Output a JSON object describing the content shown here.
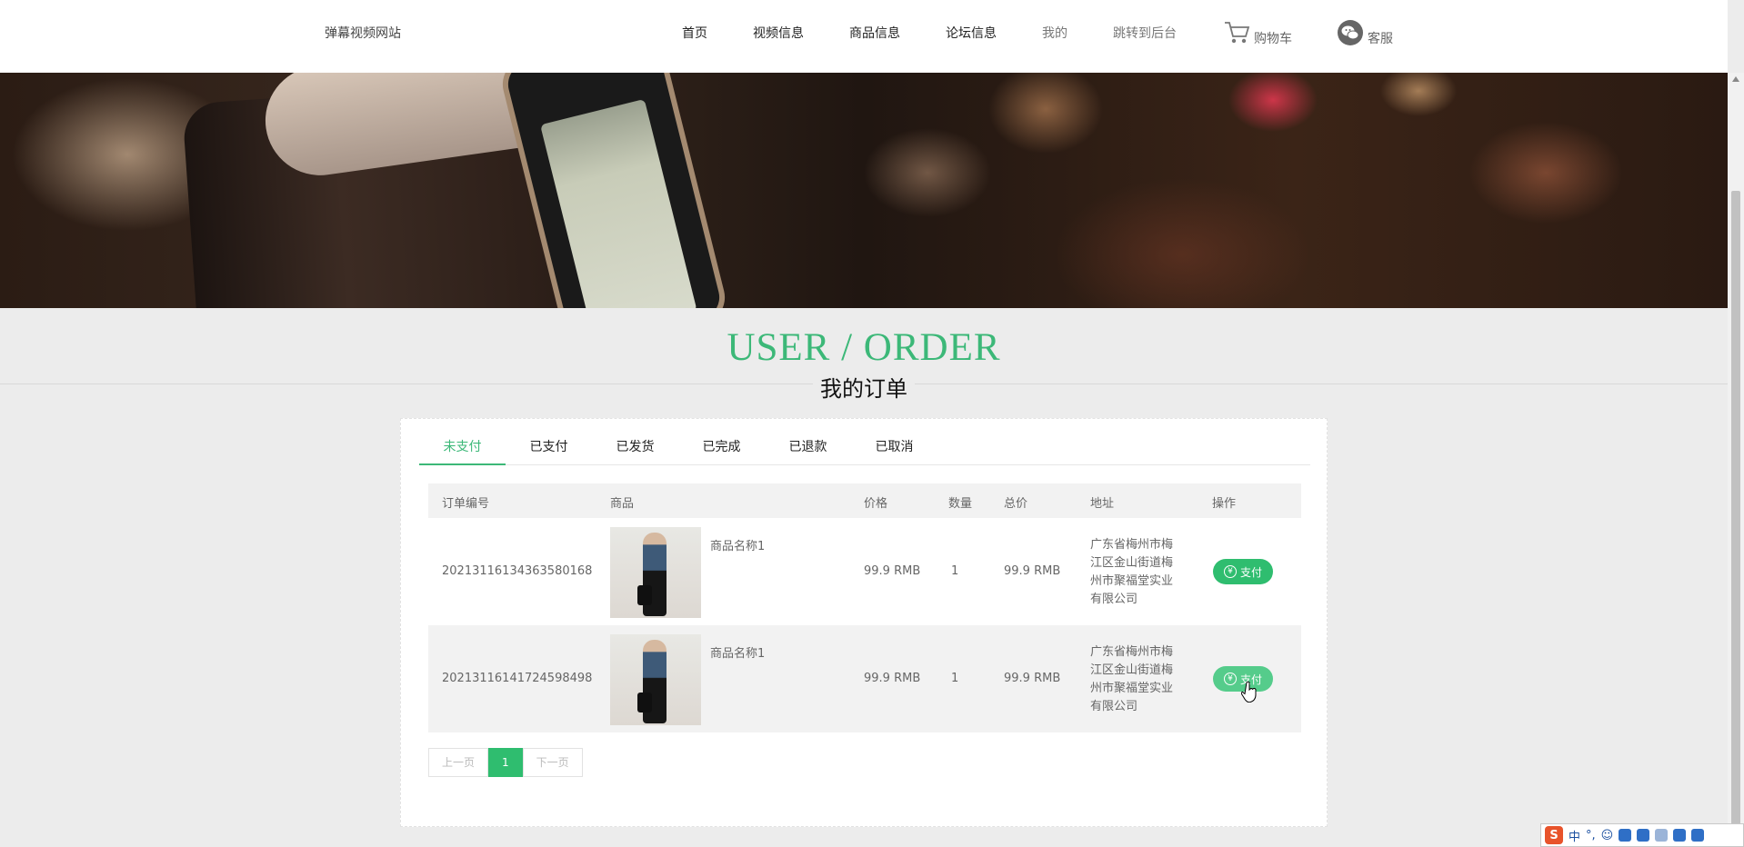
{
  "site": {
    "name": "弹幕视频网站"
  },
  "nav": {
    "items": [
      "首页",
      "视频信息",
      "商品信息",
      "论坛信息",
      "我的",
      "跳转到后台"
    ],
    "cart": "购物车",
    "service": "客服"
  },
  "page": {
    "title_en": "USER / ORDER",
    "title_cn": "我的订单"
  },
  "tabs": [
    "未支付",
    "已支付",
    "已发货",
    "已完成",
    "已退款",
    "已取消"
  ],
  "active_tab": "未支付",
  "table": {
    "headers": [
      "订单编号",
      "商品",
      "价格",
      "数量",
      "总价",
      "地址",
      "操作"
    ],
    "rows": [
      {
        "order_no": "20213116134363580168",
        "product": "商品名称1",
        "price": "99.9 RMB",
        "qty": "1",
        "total": "99.9 RMB",
        "address": "广东省梅州市梅江区金山街道梅州市聚福堂实业有限公司",
        "action": "支付"
      },
      {
        "order_no": "20213116141724598498",
        "product": "商品名称1",
        "price": "99.9 RMB",
        "qty": "1",
        "total": "99.9 RMB",
        "address": "广东省梅州市梅江区金山街道梅州市聚福堂实业有限公司",
        "action": "支付"
      }
    ]
  },
  "pagination": {
    "prev": "上一页",
    "current": "1",
    "next": "下一页"
  },
  "ime": {
    "logo": "S",
    "mode": "中"
  },
  "colors": {
    "accent": "#3cb878",
    "button": "#2fbd6f"
  }
}
